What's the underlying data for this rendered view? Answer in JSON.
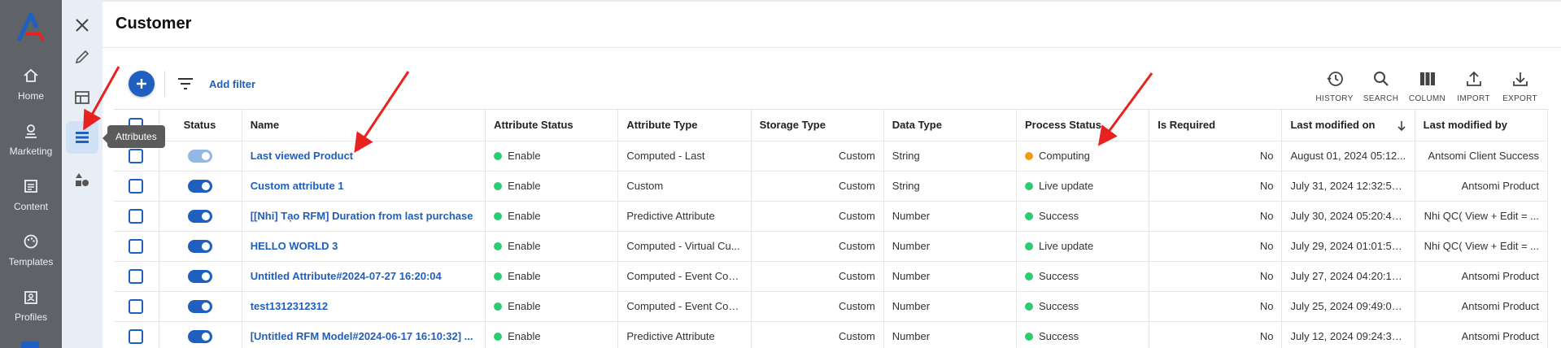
{
  "nav": {
    "items": [
      {
        "label": "Home",
        "icon": "home-icon"
      },
      {
        "label": "Marketing",
        "icon": "marketing-icon"
      },
      {
        "label": "Content",
        "icon": "content-icon"
      },
      {
        "label": "Templates",
        "icon": "palette-icon"
      },
      {
        "label": "Profiles",
        "icon": "profiles-icon"
      }
    ]
  },
  "rail": {
    "tooltip": "Attributes"
  },
  "page": {
    "title": "Customer",
    "add_filter": "Add filter"
  },
  "tools": [
    {
      "label": "HISTORY",
      "icon": "history-icon"
    },
    {
      "label": "SEARCH",
      "icon": "search-icon"
    },
    {
      "label": "COLUMN",
      "icon": "column-icon"
    },
    {
      "label": "IMPORT",
      "icon": "import-icon"
    },
    {
      "label": "EXPORT",
      "icon": "export-icon"
    }
  ],
  "table": {
    "headers": [
      "Status",
      "Name",
      "Attribute Status",
      "Attribute Type",
      "Storage Type",
      "Data Type",
      "Process Status",
      "Is Required",
      "Last modified on",
      "Last modified by"
    ],
    "rows": [
      {
        "name": "Last viewed Product",
        "attr_status": "Enable",
        "attr_type": "Computed - Last",
        "storage": "Custom",
        "dtype": "String",
        "process": "Computing",
        "process_color": "#f39c12",
        "required": "No",
        "modified_on": "August 01, 2024 05:12...",
        "modified_by": "Antsomi Client Success",
        "enabled_dim": true
      },
      {
        "name": "Custom attribute 1",
        "attr_status": "Enable",
        "attr_type": "Custom",
        "storage": "Custom",
        "dtype": "String",
        "process": "Live update",
        "process_color": "#2ecc71",
        "required": "No",
        "modified_on": "July 31, 2024 12:32:58...",
        "modified_by": "Antsomi Product",
        "enabled_dim": false
      },
      {
        "name": "[[Nhi] Tạo RFM] Duration from last purchase",
        "attr_status": "Enable",
        "attr_type": "Predictive Attribute",
        "storage": "Custom",
        "dtype": "Number",
        "process": "Success",
        "process_color": "#2ecc71",
        "required": "No",
        "modified_on": "July 30, 2024 05:20:47...",
        "modified_by": "Nhi QC( View + Edit = ...",
        "enabled_dim": false
      },
      {
        "name": "HELLO WORLD 3",
        "attr_status": "Enable",
        "attr_type": "Computed - Virtual Cu...",
        "storage": "Custom",
        "dtype": "Number",
        "process": "Live update",
        "process_color": "#2ecc71",
        "required": "No",
        "modified_on": "July 29, 2024 01:01:54...",
        "modified_by": "Nhi QC( View + Edit = ...",
        "enabled_dim": false
      },
      {
        "name": "Untitled Attribute#2024-07-27 16:20:04",
        "attr_status": "Enable",
        "attr_type": "Computed - Event Cou...",
        "storage": "Custom",
        "dtype": "Number",
        "process": "Success",
        "process_color": "#2ecc71",
        "required": "No",
        "modified_on": "July 27, 2024 04:20:13...",
        "modified_by": "Antsomi Product",
        "enabled_dim": false
      },
      {
        "name": "test1312312312",
        "attr_status": "Enable",
        "attr_type": "Computed - Event Cou...",
        "storage": "Custom",
        "dtype": "Number",
        "process": "Success",
        "process_color": "#2ecc71",
        "required": "No",
        "modified_on": "July 25, 2024 09:49:09...",
        "modified_by": "Antsomi Product",
        "enabled_dim": false
      },
      {
        "name": "[Untitled RFM Model#2024-06-17 16:10:32] ...",
        "attr_status": "Enable",
        "attr_type": "Predictive Attribute",
        "storage": "Custom",
        "dtype": "Number",
        "process": "Success",
        "process_color": "#2ecc71",
        "required": "No",
        "modified_on": "July 12, 2024 09:24:33...",
        "modified_by": "Antsomi Product",
        "enabled_dim": false
      }
    ]
  },
  "colors": {
    "accent": "#1f5fbf",
    "enable": "#2ecc71",
    "computing": "#f39c12",
    "arrow": "#e8231f"
  }
}
